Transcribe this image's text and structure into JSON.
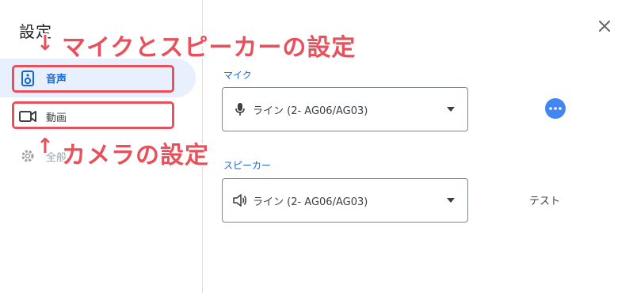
{
  "dialog": {
    "title": "設定",
    "close_icon": "close-icon"
  },
  "sidebar": {
    "items": [
      {
        "label": "音声",
        "icon": "speaker-device-icon",
        "selected": true
      },
      {
        "label": "動画",
        "icon": "videocam-icon",
        "selected": false
      },
      {
        "label": "全般",
        "icon": "gear-icon",
        "selected": false
      }
    ]
  },
  "annotations": {
    "speaker_note": "マイクとスピーカーの設定",
    "camera_note": "カメラの設定",
    "arrow_down": "↓",
    "arrow_up": "↑",
    "color": "#e8505b"
  },
  "audio": {
    "mic": {
      "label": "マイク",
      "value": "ライン (2- AG06/AG03)",
      "icon": "microphone-icon"
    },
    "speaker": {
      "label": "スピーカー",
      "value": "ライン (2- AG06/AG03)",
      "icon": "volume-icon"
    },
    "more_icon": "more-horizontal-icon",
    "test_label": "テスト"
  },
  "colors": {
    "accent": "#1967d2",
    "selected_bg": "#e8f0fe",
    "more_button": "#4285f4"
  }
}
